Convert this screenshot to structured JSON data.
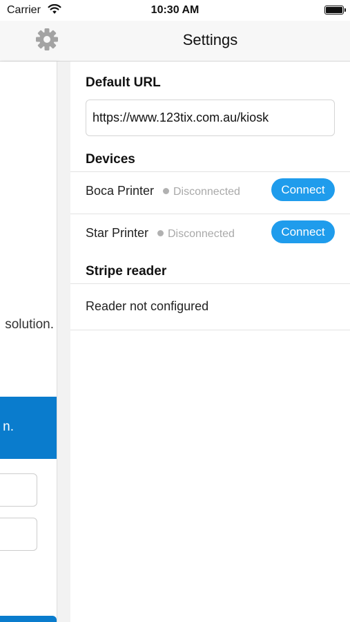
{
  "status_bar": {
    "carrier": "Carrier",
    "time": "10:30 AM"
  },
  "nav": {
    "title": "Settings",
    "settings_icon": "gear-icon"
  },
  "background": {
    "fragment_1": "solution.",
    "fragment_2": "n."
  },
  "default_url": {
    "title": "Default URL",
    "value": "https://www.123tix.com.au/kiosk"
  },
  "devices": {
    "title": "Devices",
    "items": [
      {
        "name": "Boca Printer",
        "status": "Disconnected",
        "action": "Connect"
      },
      {
        "name": "Star Printer",
        "status": "Disconnected",
        "action": "Connect"
      }
    ]
  },
  "stripe_reader": {
    "title": "Stripe reader",
    "status": "Reader not configured"
  },
  "colors": {
    "accent": "#1f9cec",
    "banner": "#0a7ccd",
    "status_dot": "#b1b1b1"
  }
}
